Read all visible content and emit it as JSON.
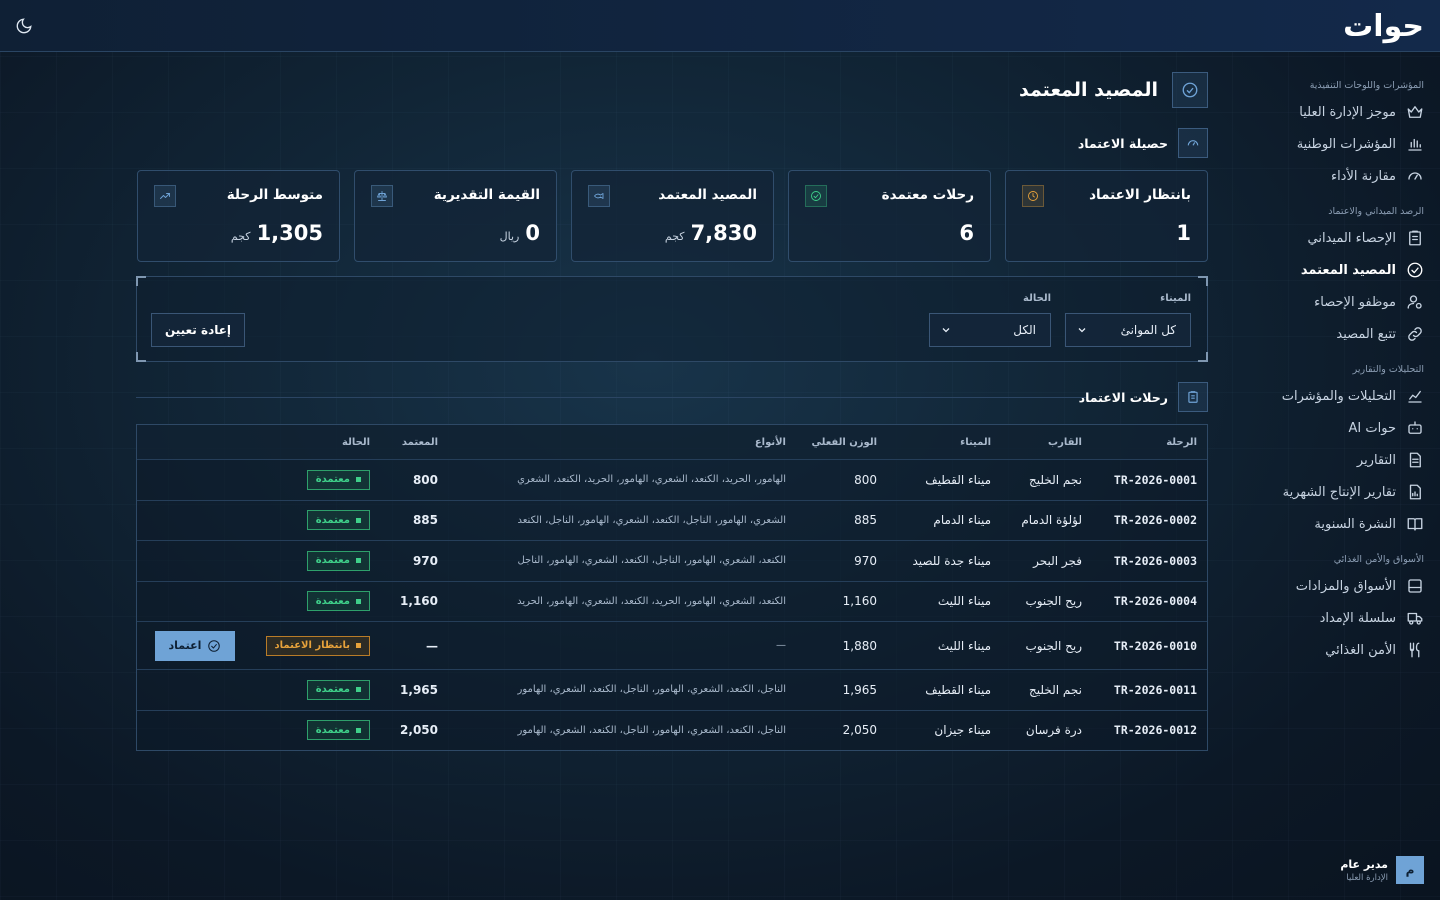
{
  "app": {
    "logo_text": "حوات"
  },
  "sidebar": {
    "sections": [
      {
        "title": "المؤشرات واللوحات التنفيذية",
        "items": [
          {
            "label": "موجز الإدارة العليا",
            "icon": "crown-icon"
          },
          {
            "label": "المؤشرات الوطنية",
            "icon": "bar-chart-icon"
          },
          {
            "label": "مقارنة الأداء",
            "icon": "gauge-icon"
          }
        ]
      },
      {
        "title": "الرصد الميداني والاعتماد",
        "items": [
          {
            "label": "الإحصاء الميداني",
            "icon": "clipboard-icon"
          },
          {
            "label": "المصيد المعتمد",
            "icon": "check-circle-icon",
            "active": true
          },
          {
            "label": "موظفو الإحصاء",
            "icon": "user-gear-icon"
          },
          {
            "label": "تتبع المصيد",
            "icon": "link-icon"
          }
        ]
      },
      {
        "title": "التحليلات والتقارير",
        "items": [
          {
            "label": "التحليلات والمؤشرات",
            "icon": "line-chart-icon"
          },
          {
            "label": "حوات AI",
            "icon": "bot-icon"
          },
          {
            "label": "التقارير",
            "icon": "file-text-icon"
          },
          {
            "label": "تقارير الإنتاج الشهرية",
            "icon": "file-chart-icon"
          },
          {
            "label": "النشرة السنوية",
            "icon": "book-icon"
          }
        ]
      },
      {
        "title": "الأسواق والأمن الغذائي",
        "items": [
          {
            "label": "الأسواق والمزادات",
            "icon": "store-icon"
          },
          {
            "label": "سلسلة الإمداد",
            "icon": "truck-icon"
          },
          {
            "label": "الأمن الغذائي",
            "icon": "utensils-icon"
          }
        ]
      }
    ]
  },
  "user": {
    "initial": "م",
    "name": "مدير عام",
    "role": "الإدارة العليا"
  },
  "page": {
    "title": "المصيد المعتمد",
    "summary_title": "حصيلة الاعتماد",
    "trips_title": "رحلات الاعتماد"
  },
  "cards": [
    {
      "title": "بانتظار الاعتماد",
      "value": "1",
      "unit": "",
      "icon": "clock-icon",
      "accent": "#e7a23b"
    },
    {
      "title": "رحلات معتمدة",
      "value": "6",
      "unit": "",
      "icon": "check-circle-icon",
      "accent": "#3fd08a"
    },
    {
      "title": "المصيد المعتمد",
      "value": "7,830",
      "unit": "كجم",
      "icon": "fish-icon",
      "accent": "#6fa3d6"
    },
    {
      "title": "القيمة التقديرية",
      "value": "0",
      "unit": "ريال",
      "icon": "scale-icon",
      "accent": "#6fa3d6"
    },
    {
      "title": "متوسط الرحلة",
      "value": "1,305",
      "unit": "كجم",
      "icon": "trend-icon",
      "accent": "#6fa3d6"
    }
  ],
  "filters": {
    "port_label": "الميناء",
    "port_value": "كل الموانئ",
    "status_label": "الحالة",
    "status_value": "الكل",
    "reset_label": "إعادة تعيين"
  },
  "table": {
    "headers": {
      "trip": "الرحلة",
      "boat": "القارب",
      "port": "الميناء",
      "weight": "الوزن الفعلي",
      "types": "الأنواع",
      "approved": "المعتمد",
      "status": "الحالة"
    },
    "rows": [
      {
        "trip": "TR-2026-0001",
        "boat": "نجم الخليج",
        "port": "ميناء القطيف",
        "weight": "800",
        "types": "الهامور، الحريد، الكنعد، الشعري، الهامور، الحريد، الكنعد، الشعري",
        "approved": "800",
        "status": "معتمدة",
        "state": "ok"
      },
      {
        "trip": "TR-2026-0002",
        "boat": "لؤلؤة الدمام",
        "port": "ميناء الدمام",
        "weight": "885",
        "types": "الشعري، الهامور، الناجل، الكنعد، الشعري، الهامور، الناجل، الكنعد",
        "approved": "885",
        "status": "معتمدة",
        "state": "ok"
      },
      {
        "trip": "TR-2026-0003",
        "boat": "فجر البحر",
        "port": "ميناء جدة للصيد",
        "weight": "970",
        "types": "الكنعد، الشعري، الهامور، الناجل، الكنعد، الشعري، الهامور، الناجل",
        "approved": "970",
        "status": "معتمدة",
        "state": "ok"
      },
      {
        "trip": "TR-2026-0004",
        "boat": "ريح الجنوب",
        "port": "ميناء الليث",
        "weight": "1,160",
        "types": "الكنعد، الشعري، الهامور، الحريد، الكنعد، الشعري، الهامور، الحريد",
        "approved": "1,160",
        "status": "معتمدة",
        "state": "ok"
      },
      {
        "trip": "TR-2026-0010",
        "boat": "ريح الجنوب",
        "port": "ميناء الليث",
        "weight": "1,880",
        "types": "—",
        "approved": "—",
        "status": "بانتظار الاعتماد",
        "state": "pend",
        "action": "اعتماد"
      },
      {
        "trip": "TR-2026-0011",
        "boat": "نجم الخليج",
        "port": "ميناء القطيف",
        "weight": "1,965",
        "types": "الناجل، الكنعد، الشعري، الهامور، الناجل، الكنعد، الشعري، الهامور",
        "approved": "1,965",
        "status": "معتمدة",
        "state": "ok"
      },
      {
        "trip": "TR-2026-0012",
        "boat": "درة فرسان",
        "port": "ميناء جيزان",
        "weight": "2,050",
        "types": "الناجل، الكنعد، الشعري، الهامور، الناجل، الكنعد، الشعري، الهامور",
        "approved": "2,050",
        "status": "معتمدة",
        "state": "ok"
      }
    ]
  }
}
